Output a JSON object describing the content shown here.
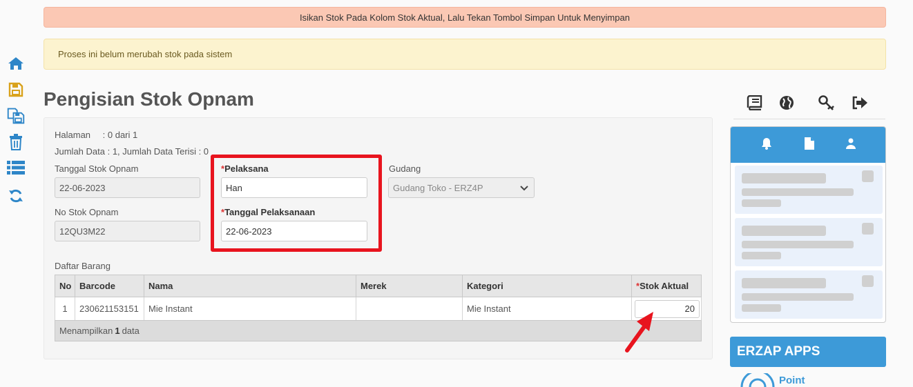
{
  "alerts": {
    "instruction": "Isikan Stok Pada Kolom Stok Aktual, Lalu Tekan Tombol Simpan Untuk Menyimpan",
    "warning": "Proses ini belum merubah stok pada sistem"
  },
  "page": {
    "title": "Pengisian Stok Opnam"
  },
  "info": {
    "halaman_label": "Halaman",
    "halaman_value": ": 0 dari 1",
    "jumlah_data": "Jumlah Data : 1, Jumlah Data Terisi : 0"
  },
  "form": {
    "tanggal_stok_label": "Tanggal Stok Opnam",
    "tanggal_stok_value": "22-06-2023",
    "no_stok_label": "No Stok Opnam",
    "no_stok_value": "12QU3M22",
    "pelaksana_star": "*",
    "pelaksana_label": "Pelaksana",
    "pelaksana_value": "Han",
    "tanggal_pelaksanaan_star": "*",
    "tanggal_pelaksanaan_label": "Tanggal Pelaksanaan",
    "tanggal_pelaksanaan_value": "22-06-2023",
    "gudang_label": "Gudang",
    "gudang_value": "Gudang Toko - ERZ4P"
  },
  "table": {
    "section_label": "Daftar Barang",
    "headers": {
      "no": "No",
      "barcode": "Barcode",
      "nama": "Nama",
      "merek": "Merek",
      "kategori": "Kategori",
      "stok_star": "*",
      "stok": "Stok Aktual"
    },
    "rows": [
      {
        "no": "1",
        "barcode": "230621153151",
        "nama": "Mie Instant",
        "merek": "",
        "kategori": "Mie Instant",
        "stok": "20"
      }
    ],
    "footer_prefix": "Menampilkan ",
    "footer_count": "1",
    "footer_suffix": " data"
  },
  "sidebar_right": {
    "apps_title": "ERZAP APPS",
    "apps_peek": "Point"
  },
  "icons": {
    "left": [
      "home-icon",
      "save-icon",
      "save-multiple-icon",
      "trash-icon",
      "list-icon",
      "refresh-icon"
    ],
    "right": [
      "book-icon",
      "globe-icon",
      "key-icon",
      "logout-icon"
    ],
    "notif_tabs": [
      "bell-icon",
      "document-icon",
      "user-icon"
    ]
  },
  "colors": {
    "accent": "#3d9ad8",
    "highlight": "#e8141e",
    "alert_top": "#fbc8b4",
    "alert_warn": "#fcf3cf",
    "icon_blue": "#2e86c8",
    "icon_gold": "#d9a21b"
  }
}
